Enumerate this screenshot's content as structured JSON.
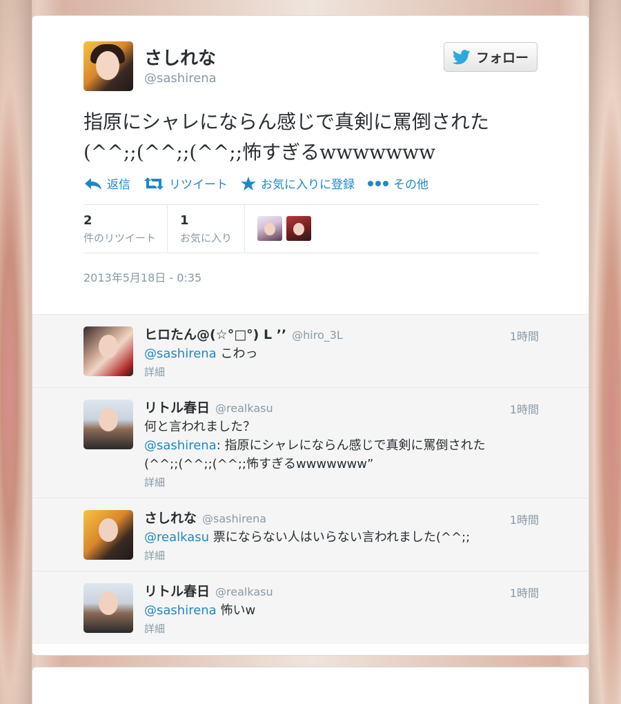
{
  "tweet": {
    "author_name": "さしれな",
    "author_handle": "@sashirena",
    "follow_label": "フォロー",
    "text_line1": "指原にシャレにならん感じで真剣に罵倒された",
    "text_line2": "(^^;;(^^;;(^^;;怖すぎるwwwwwww",
    "actions": {
      "reply": "返信",
      "retweet": "リツイート",
      "favorite": "お気に入りに登録",
      "more": "その他"
    },
    "stats": {
      "retweet_count": "2",
      "retweet_label": "件のリツイート",
      "favorite_count": "1",
      "favorite_label": "お気に入り"
    },
    "timestamp": "2013年5月18日 - 0:35"
  },
  "replies": [
    {
      "name": "ヒロたん@(☆°□°) L ’’",
      "handle": "@hiro_3L",
      "time": "1時間",
      "mention": "@sashirena",
      "text": " こわっ",
      "detail": "詳細"
    },
    {
      "name": "リトル春日",
      "handle": "@realkasu",
      "time": "1時間",
      "pre_text": "何と言われました？",
      "mention": "@sashirena",
      "text": ": 指原にシャレにならん感じで真剣に罵倒された",
      "text2": "(^^;;(^^;;(^^;;怖すぎるwwwwwww”",
      "detail": "詳細"
    },
    {
      "name": "さしれな",
      "handle": "@sashirena",
      "time": "1時間",
      "mention": "@realkasu",
      "text": " 票にならない人はいらない言われました(^^;;",
      "detail": "詳細"
    },
    {
      "name": "リトル春日",
      "handle": "@realkasu",
      "time": "1時間",
      "mention": "@sashirena",
      "text": " 怖いw",
      "detail": "詳細"
    }
  ],
  "colors": {
    "link": "#1e88c8",
    "muted": "#8899a6",
    "text": "#292f33"
  }
}
